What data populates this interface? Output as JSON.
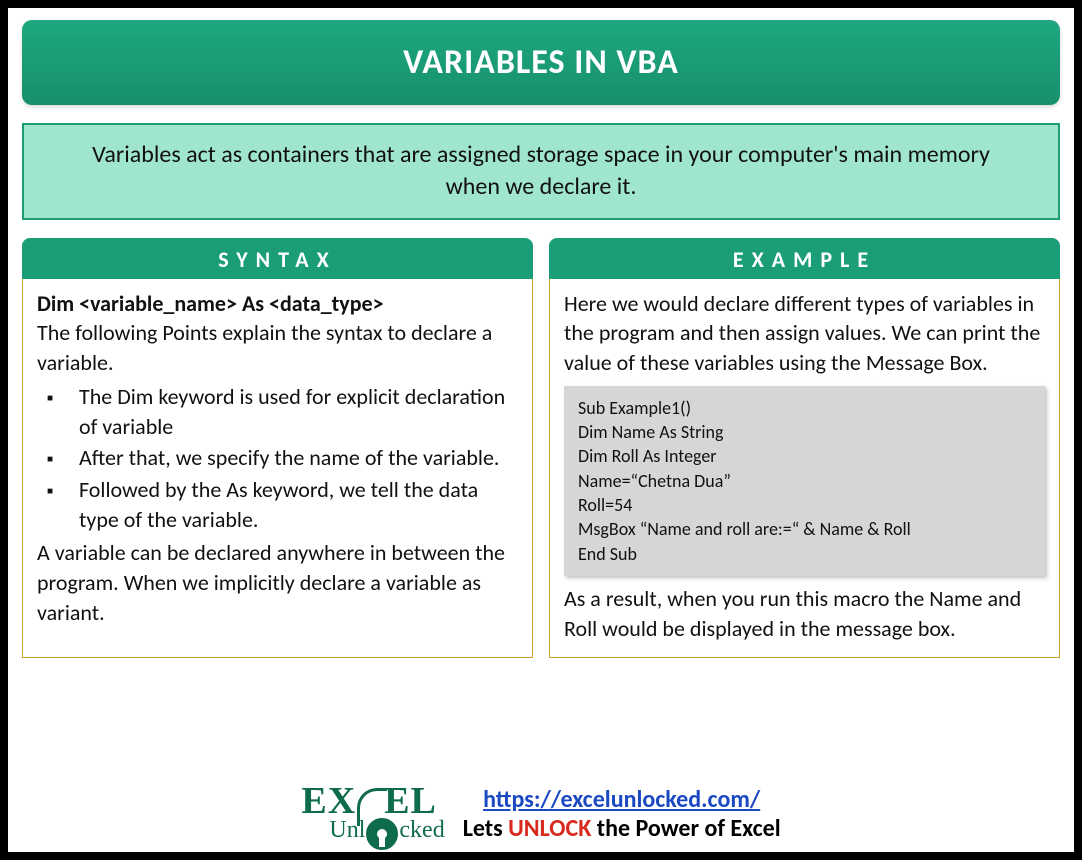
{
  "title": "VARIABLES IN VBA",
  "description": "Variables act as containers that are assigned storage space in your computer's main memory when we declare it.",
  "syntax": {
    "header": "SYNTAX",
    "declaration": "Dim <variable_name> As <data_type>",
    "intro": "The following Points explain the syntax to declare a variable.",
    "points": [
      "The Dim keyword is used for explicit declaration of variable",
      "After that, we specify the name of the variable.",
      "Followed by the As keyword, we tell the data type of the variable."
    ],
    "outro": "A variable can be declared anywhere in between the program. When we implicitly declare a variable as variant."
  },
  "example": {
    "header": "EXAMPLE",
    "intro": "Here we would declare different types of variables in the program and then assign values. We can print the value of these variables using the Message Box.",
    "code_lines": [
      "Sub Example1()",
      "Dim Name As String",
      "Dim Roll As Integer",
      "Name=“Chetna Dua”",
      "Roll=54",
      "MsgBox “Name and roll are:=“ & Name & Roll",
      "End Sub"
    ],
    "outro": "As a result, when you run this macro the Name and Roll would be displayed in the message box."
  },
  "footer": {
    "logo_top_left": "EX",
    "logo_top_right": "EL",
    "logo_bottom_left": "Unl",
    "logo_bottom_right": "cked",
    "url": "https://excelunlocked.com/",
    "tagline_prefix": "Lets ",
    "tagline_highlight": "UNLOCK",
    "tagline_suffix": " the Power of Excel"
  }
}
